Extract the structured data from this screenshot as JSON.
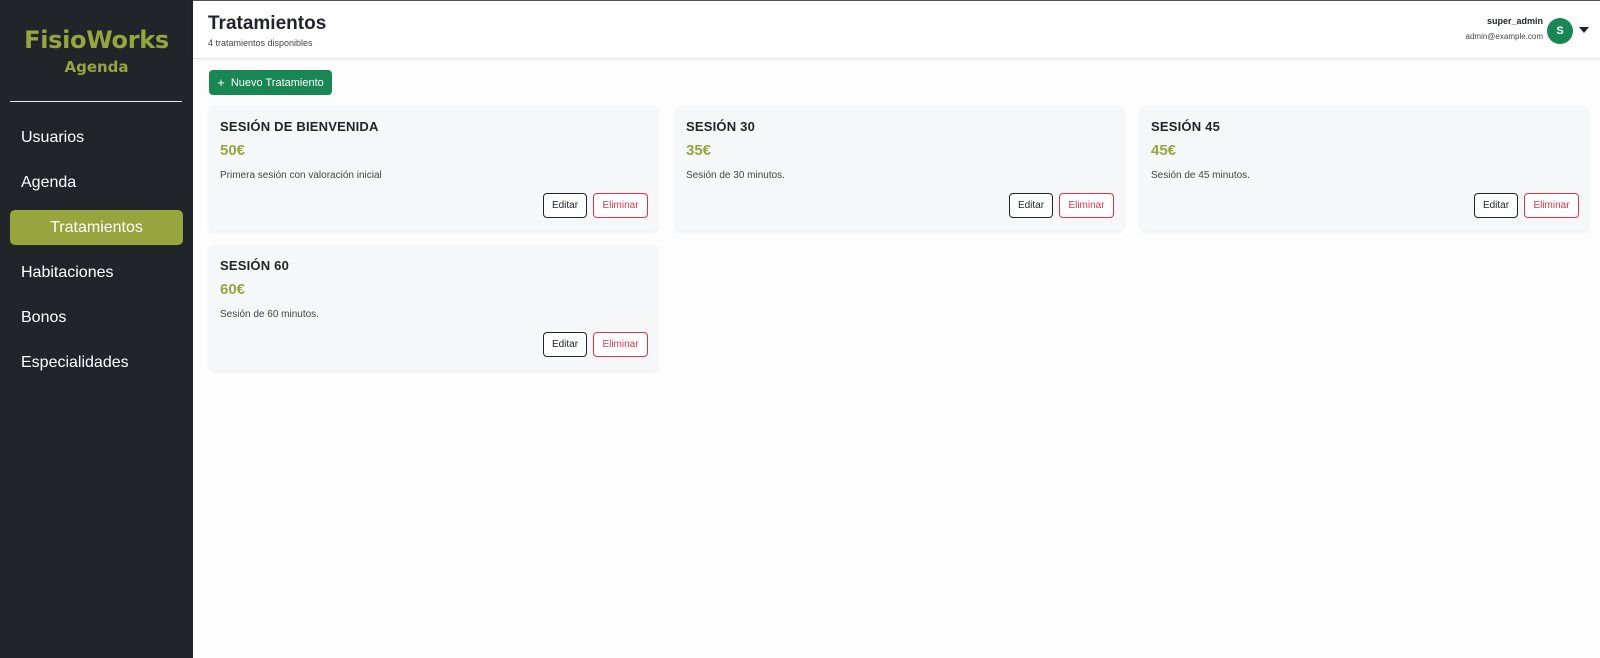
{
  "sidebar": {
    "brand": "FisioWorks",
    "subtitle": "Agenda",
    "items": [
      {
        "label": "Usuarios"
      },
      {
        "label": "Agenda"
      },
      {
        "label": "Tratamientos",
        "active": true
      },
      {
        "label": "Habitaciones"
      },
      {
        "label": "Bonos"
      },
      {
        "label": "Especialidades"
      }
    ]
  },
  "header": {
    "title": "Tratamientos",
    "subtitle": "4 tratamientos disponibles",
    "user_name": "super_admin",
    "user_email": "admin@example.com",
    "avatar_initial": "S"
  },
  "toolbar": {
    "new_label": "Nuevo Tratamiento"
  },
  "treatments": [
    {
      "title": "SESIÓN DE BIENVENIDA",
      "price": "50€",
      "description": "Primera sesión con valoración inicial",
      "edit_label": "Editar",
      "delete_label": "Eliminar"
    },
    {
      "title": "SESIÓN 30",
      "price": "35€",
      "description": "Sesión de 30 minutos.",
      "edit_label": "Editar",
      "delete_label": "Eliminar"
    },
    {
      "title": "SESIÓN 45",
      "price": "45€",
      "description": "Sesión de 45 minutos.",
      "edit_label": "Editar",
      "delete_label": "Eliminar"
    },
    {
      "title": "SESIÓN 60",
      "price": "60€",
      "description": "Sesión de 60 minutos.",
      "edit_label": "Editar",
      "delete_label": "Eliminar"
    }
  ],
  "colors": {
    "sidebar_bg": "#212529",
    "accent": "#97a53f",
    "primary": "#198754",
    "danger": "#dc3545"
  },
  "icons": {
    "new_button": "plus-icon",
    "user_menu": "caret-down-icon"
  }
}
